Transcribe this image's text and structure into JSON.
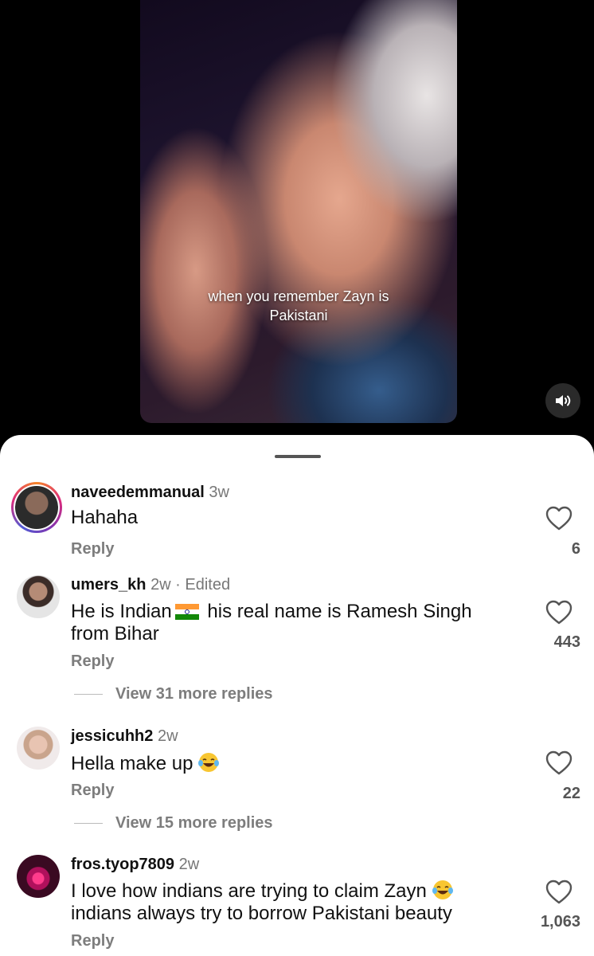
{
  "video": {
    "caption": "when you remember Zayn is Pakistani",
    "mute_icon": "speaker-icon"
  },
  "comments": [
    {
      "username": "naveedemmanual",
      "time": "3w",
      "text": "Hahaha",
      "reply_label": "Reply",
      "likes": "6"
    },
    {
      "username": "umers_kh",
      "time": "2w · Edited",
      "text_before": "He is Indian",
      "text_after": "his real name is Ramesh Singh from Bihar",
      "reply_label": "Reply",
      "likes": "443",
      "view_replies": "View 31 more replies"
    },
    {
      "username": "jessicuhh2",
      "time": "2w",
      "text": "Hella make up",
      "reply_label": "Reply",
      "likes": "22",
      "view_replies": "View 15 more replies"
    },
    {
      "username": "fros.tyop7809",
      "time": "2w",
      "text_before": "I love how indians are trying to claim Zayn",
      "text_after": "indians always try to borrow Pakistani beauty",
      "reply_label": "Reply",
      "likes": "1,063"
    }
  ],
  "colors": {
    "story_ring_start": "#f58529",
    "story_ring_end": "#515bd4",
    "secondary_text": "#7d7d7d"
  }
}
